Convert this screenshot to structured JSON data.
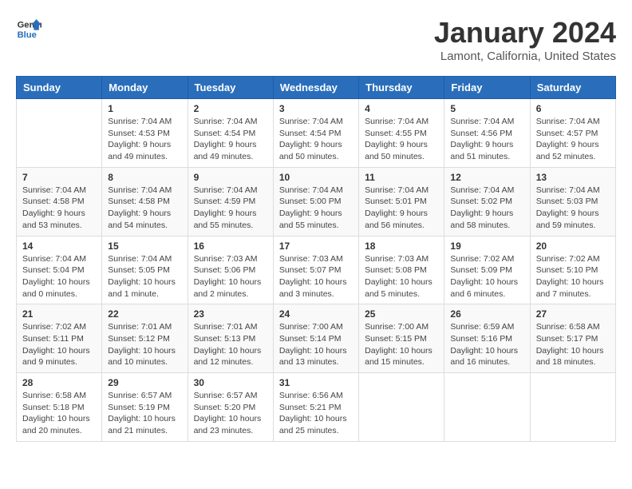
{
  "logo": {
    "line1": "General",
    "line2": "Blue"
  },
  "title": "January 2024",
  "subtitle": "Lamont, California, United States",
  "days_header": [
    "Sunday",
    "Monday",
    "Tuesday",
    "Wednesday",
    "Thursday",
    "Friday",
    "Saturday"
  ],
  "weeks": [
    [
      {
        "day": "",
        "sunrise": "",
        "sunset": "",
        "daylight": ""
      },
      {
        "day": "1",
        "sunrise": "Sunrise: 7:04 AM",
        "sunset": "Sunset: 4:53 PM",
        "daylight": "Daylight: 9 hours and 49 minutes."
      },
      {
        "day": "2",
        "sunrise": "Sunrise: 7:04 AM",
        "sunset": "Sunset: 4:54 PM",
        "daylight": "Daylight: 9 hours and 49 minutes."
      },
      {
        "day": "3",
        "sunrise": "Sunrise: 7:04 AM",
        "sunset": "Sunset: 4:54 PM",
        "daylight": "Daylight: 9 hours and 50 minutes."
      },
      {
        "day": "4",
        "sunrise": "Sunrise: 7:04 AM",
        "sunset": "Sunset: 4:55 PM",
        "daylight": "Daylight: 9 hours and 50 minutes."
      },
      {
        "day": "5",
        "sunrise": "Sunrise: 7:04 AM",
        "sunset": "Sunset: 4:56 PM",
        "daylight": "Daylight: 9 hours and 51 minutes."
      },
      {
        "day": "6",
        "sunrise": "Sunrise: 7:04 AM",
        "sunset": "Sunset: 4:57 PM",
        "daylight": "Daylight: 9 hours and 52 minutes."
      }
    ],
    [
      {
        "day": "7",
        "sunrise": "Sunrise: 7:04 AM",
        "sunset": "Sunset: 4:58 PM",
        "daylight": "Daylight: 9 hours and 53 minutes."
      },
      {
        "day": "8",
        "sunrise": "Sunrise: 7:04 AM",
        "sunset": "Sunset: 4:58 PM",
        "daylight": "Daylight: 9 hours and 54 minutes."
      },
      {
        "day": "9",
        "sunrise": "Sunrise: 7:04 AM",
        "sunset": "Sunset: 4:59 PM",
        "daylight": "Daylight: 9 hours and 55 minutes."
      },
      {
        "day": "10",
        "sunrise": "Sunrise: 7:04 AM",
        "sunset": "Sunset: 5:00 PM",
        "daylight": "Daylight: 9 hours and 55 minutes."
      },
      {
        "day": "11",
        "sunrise": "Sunrise: 7:04 AM",
        "sunset": "Sunset: 5:01 PM",
        "daylight": "Daylight: 9 hours and 56 minutes."
      },
      {
        "day": "12",
        "sunrise": "Sunrise: 7:04 AM",
        "sunset": "Sunset: 5:02 PM",
        "daylight": "Daylight: 9 hours and 58 minutes."
      },
      {
        "day": "13",
        "sunrise": "Sunrise: 7:04 AM",
        "sunset": "Sunset: 5:03 PM",
        "daylight": "Daylight: 9 hours and 59 minutes."
      }
    ],
    [
      {
        "day": "14",
        "sunrise": "Sunrise: 7:04 AM",
        "sunset": "Sunset: 5:04 PM",
        "daylight": "Daylight: 10 hours and 0 minutes."
      },
      {
        "day": "15",
        "sunrise": "Sunrise: 7:04 AM",
        "sunset": "Sunset: 5:05 PM",
        "daylight": "Daylight: 10 hours and 1 minute."
      },
      {
        "day": "16",
        "sunrise": "Sunrise: 7:03 AM",
        "sunset": "Sunset: 5:06 PM",
        "daylight": "Daylight: 10 hours and 2 minutes."
      },
      {
        "day": "17",
        "sunrise": "Sunrise: 7:03 AM",
        "sunset": "Sunset: 5:07 PM",
        "daylight": "Daylight: 10 hours and 3 minutes."
      },
      {
        "day": "18",
        "sunrise": "Sunrise: 7:03 AM",
        "sunset": "Sunset: 5:08 PM",
        "daylight": "Daylight: 10 hours and 5 minutes."
      },
      {
        "day": "19",
        "sunrise": "Sunrise: 7:02 AM",
        "sunset": "Sunset: 5:09 PM",
        "daylight": "Daylight: 10 hours and 6 minutes."
      },
      {
        "day": "20",
        "sunrise": "Sunrise: 7:02 AM",
        "sunset": "Sunset: 5:10 PM",
        "daylight": "Daylight: 10 hours and 7 minutes."
      }
    ],
    [
      {
        "day": "21",
        "sunrise": "Sunrise: 7:02 AM",
        "sunset": "Sunset: 5:11 PM",
        "daylight": "Daylight: 10 hours and 9 minutes."
      },
      {
        "day": "22",
        "sunrise": "Sunrise: 7:01 AM",
        "sunset": "Sunset: 5:12 PM",
        "daylight": "Daylight: 10 hours and 10 minutes."
      },
      {
        "day": "23",
        "sunrise": "Sunrise: 7:01 AM",
        "sunset": "Sunset: 5:13 PM",
        "daylight": "Daylight: 10 hours and 12 minutes."
      },
      {
        "day": "24",
        "sunrise": "Sunrise: 7:00 AM",
        "sunset": "Sunset: 5:14 PM",
        "daylight": "Daylight: 10 hours and 13 minutes."
      },
      {
        "day": "25",
        "sunrise": "Sunrise: 7:00 AM",
        "sunset": "Sunset: 5:15 PM",
        "daylight": "Daylight: 10 hours and 15 minutes."
      },
      {
        "day": "26",
        "sunrise": "Sunrise: 6:59 AM",
        "sunset": "Sunset: 5:16 PM",
        "daylight": "Daylight: 10 hours and 16 minutes."
      },
      {
        "day": "27",
        "sunrise": "Sunrise: 6:58 AM",
        "sunset": "Sunset: 5:17 PM",
        "daylight": "Daylight: 10 hours and 18 minutes."
      }
    ],
    [
      {
        "day": "28",
        "sunrise": "Sunrise: 6:58 AM",
        "sunset": "Sunset: 5:18 PM",
        "daylight": "Daylight: 10 hours and 20 minutes."
      },
      {
        "day": "29",
        "sunrise": "Sunrise: 6:57 AM",
        "sunset": "Sunset: 5:19 PM",
        "daylight": "Daylight: 10 hours and 21 minutes."
      },
      {
        "day": "30",
        "sunrise": "Sunrise: 6:57 AM",
        "sunset": "Sunset: 5:20 PM",
        "daylight": "Daylight: 10 hours and 23 minutes."
      },
      {
        "day": "31",
        "sunrise": "Sunrise: 6:56 AM",
        "sunset": "Sunset: 5:21 PM",
        "daylight": "Daylight: 10 hours and 25 minutes."
      },
      {
        "day": "",
        "sunrise": "",
        "sunset": "",
        "daylight": ""
      },
      {
        "day": "",
        "sunrise": "",
        "sunset": "",
        "daylight": ""
      },
      {
        "day": "",
        "sunrise": "",
        "sunset": "",
        "daylight": ""
      }
    ]
  ]
}
